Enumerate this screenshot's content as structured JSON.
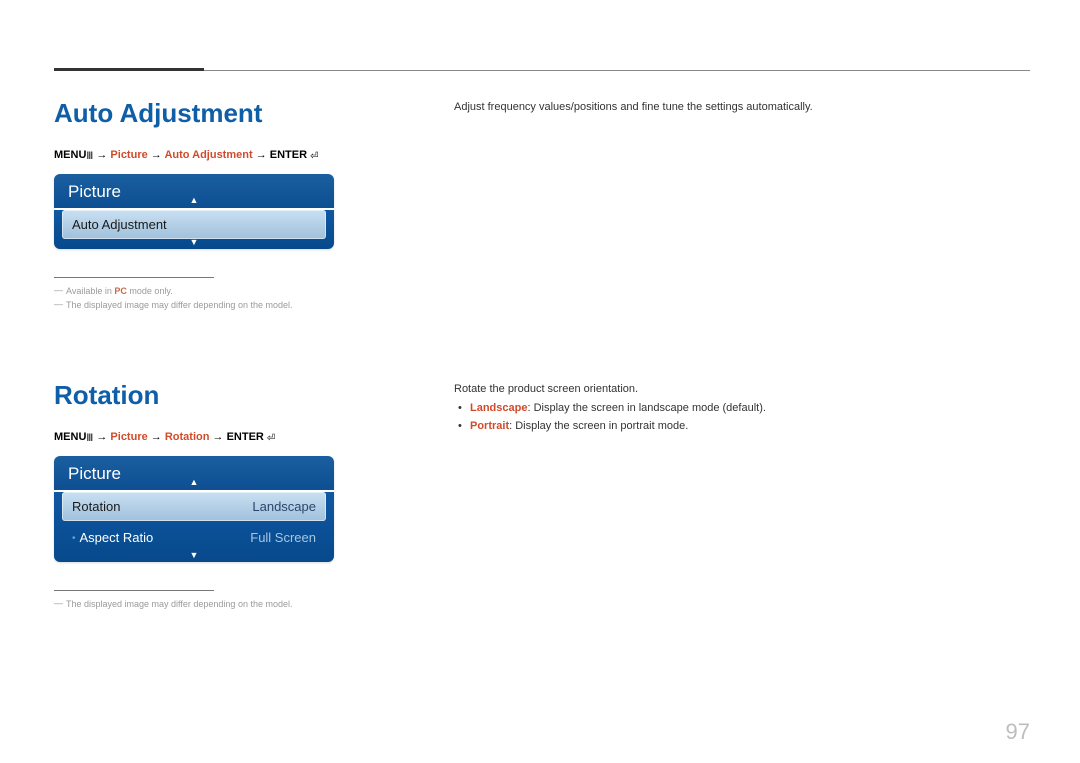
{
  "page_number": "97",
  "section1": {
    "heading": "Auto Adjustment",
    "breadcrumb": {
      "menu": "MENU",
      "menu_icon": "Ⅲ",
      "arrow": " → ",
      "picture": "Picture",
      "item": "Auto Adjustment",
      "enter": "ENTER",
      "enter_icon": "⏎"
    },
    "panel": {
      "header": "Picture",
      "selected_label": "Auto Adjustment"
    },
    "footnotes": {
      "a_pre": "Available in ",
      "a_pc": "PC",
      "a_post": " mode only.",
      "b": "The displayed image may differ depending on the model."
    },
    "right_text": "Adjust frequency values/positions and fine tune the settings automatically."
  },
  "section2": {
    "heading": "Rotation",
    "breadcrumb": {
      "menu": "MENU",
      "menu_icon": "Ⅲ",
      "arrow": " → ",
      "picture": "Picture",
      "item": "Rotation",
      "enter": "ENTER",
      "enter_icon": "⏎"
    },
    "panel": {
      "header": "Picture",
      "rows": [
        {
          "label": "Rotation",
          "value": "Landscape",
          "selected": true
        },
        {
          "label": "Aspect Ratio",
          "value": "Full Screen",
          "selected": false
        }
      ]
    },
    "footnote": "The displayed image may differ depending on the model.",
    "right": {
      "intro": "Rotate the product screen orientation.",
      "b1_label": "Landscape",
      "b1_text": ": Display the screen in landscape mode (default).",
      "b2_label": "Portrait",
      "b2_text": ": Display the screen in portrait mode."
    }
  }
}
